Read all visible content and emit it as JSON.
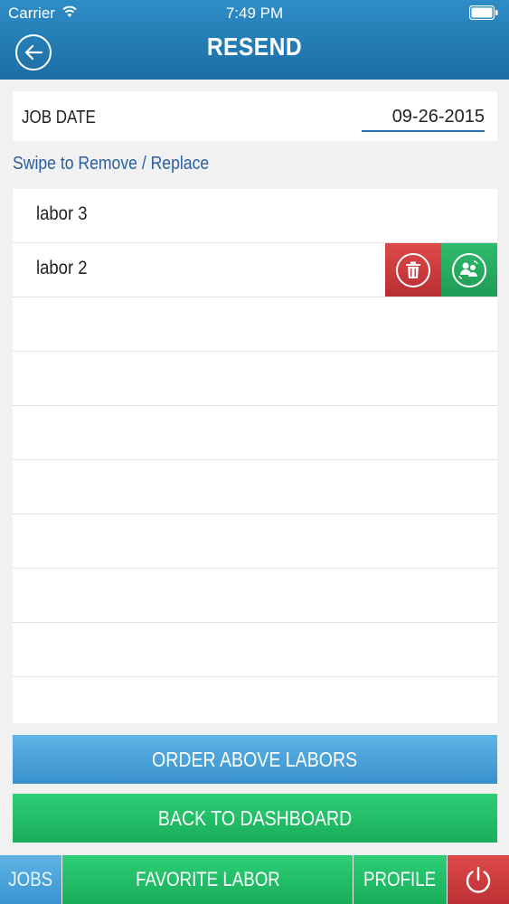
{
  "status_bar": {
    "carrier": "Carrier",
    "time": "7:49 PM"
  },
  "header": {
    "title": "RESEND",
    "back_icon": "back-arrow-icon"
  },
  "job_date": {
    "label": "JOB DATE",
    "value": "09-26-2015"
  },
  "hint": "Swipe to Remove / Replace",
  "labors": [
    {
      "label": "labor 3"
    },
    {
      "label": "labor 2",
      "swipe_actions": [
        "trash-icon",
        "replace-user-icon"
      ]
    }
  ],
  "buttons": {
    "order": "ORDER ABOVE LABORS",
    "dashboard": "BACK TO DASHBOARD"
  },
  "tabs": {
    "jobs": "JOBS",
    "favorite": "FAVORITE LABOR",
    "profile": "PROFILE",
    "logout_icon": "power-icon"
  },
  "colors": {
    "header": "#1f75ad",
    "blue_button": "#4aa3da",
    "green_button": "#22be66",
    "red_button": "#cf3b3e",
    "hint_text": "#2a5f9e"
  }
}
